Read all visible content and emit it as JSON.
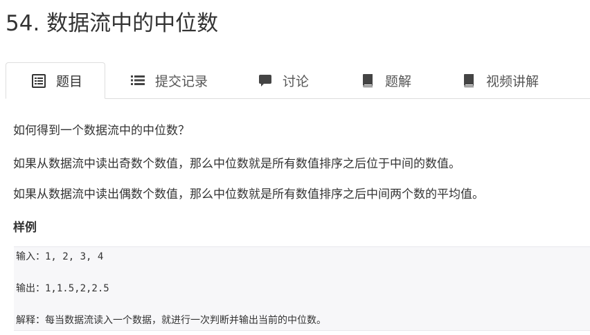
{
  "problem": {
    "title": "54. 数据流中的中位数"
  },
  "tabs": [
    {
      "label": "题目",
      "icon": "document-list-icon",
      "active": true
    },
    {
      "label": "提交记录",
      "icon": "list-icon",
      "active": false
    },
    {
      "label": "讨论",
      "icon": "comment-icon",
      "active": false
    },
    {
      "label": "题解",
      "icon": "book-icon",
      "active": false
    },
    {
      "label": "视频讲解",
      "icon": "book-icon",
      "active": false
    }
  ],
  "description": {
    "paragraphs": [
      "如何得到一个数据流中的中位数？",
      "如果从数据流中读出奇数个数值，那么中位数就是所有数值排序之后位于中间的数值。",
      "如果从数据流中读出偶数个数值，那么中位数就是所有数值排序之后中间两个数的平均值。"
    ],
    "example_heading": "样例"
  },
  "example": {
    "lines": [
      "输入：1, 2, 3, 4",
      "输出：1,1.5,2,2.5",
      "解释：每当数据流读入一个数据，就进行一次判断并输出当前的中位数。"
    ]
  },
  "colors": {
    "text": "#333333",
    "tab_text": "#555555",
    "border": "#dddddd",
    "code_bg": "#f7f7f9",
    "icon": "#333333"
  }
}
